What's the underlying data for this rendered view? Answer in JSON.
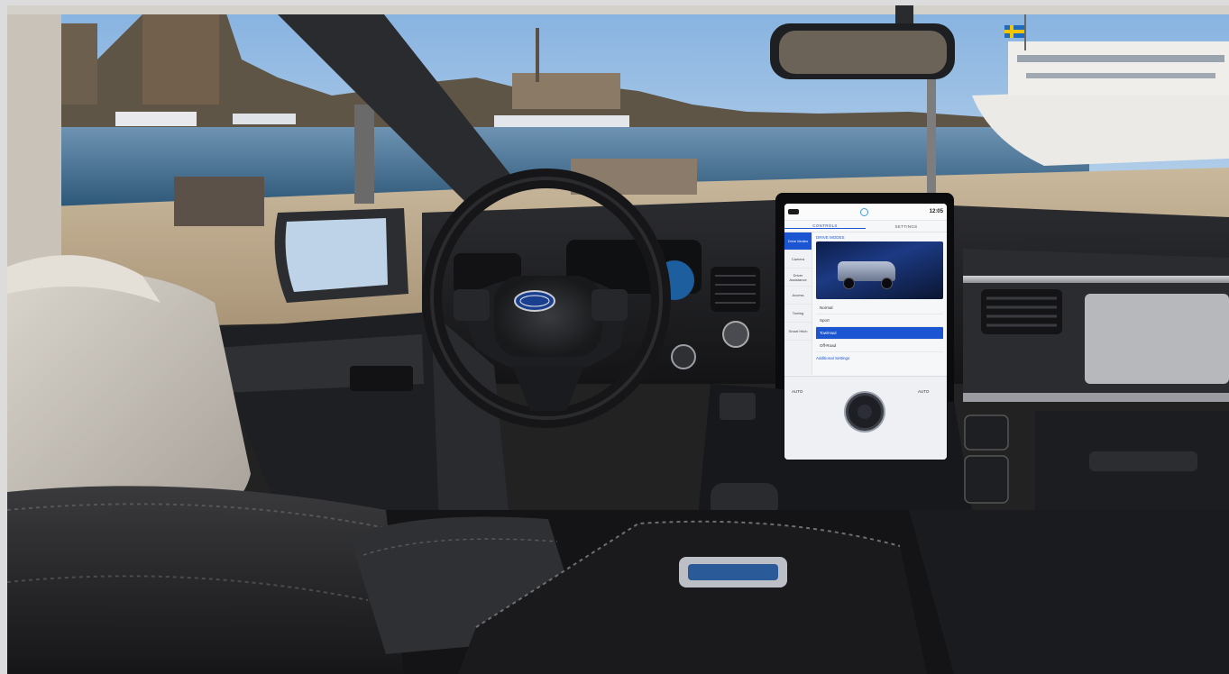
{
  "scene": {
    "subject": "pickup-truck-interior",
    "accent_colors": {
      "sky": "#9dc4ea",
      "water": "#2f5d7e",
      "leather": "#2a2a2c",
      "screen_blue": "#1b55d1"
    }
  },
  "infotainment": {
    "time": "12:05",
    "tabs": [
      "CONTROLS",
      "SETTINGS"
    ],
    "active_tab": "CONTROLS",
    "section_title": "DRIVE MODES",
    "sidebar": [
      {
        "label": "Drive Modes",
        "active": true
      },
      {
        "label": "Camera",
        "active": false
      },
      {
        "label": "Driver Assistance",
        "active": false
      },
      {
        "label": "Access",
        "active": false
      },
      {
        "label": "Towing",
        "active": false
      },
      {
        "label": "Smart Hitch",
        "active": false
      }
    ],
    "modes": [
      {
        "label": "Normal",
        "active": false
      },
      {
        "label": "Sport",
        "active": false
      },
      {
        "label": "Tow/Haul",
        "active": true
      },
      {
        "label": "Off-Road",
        "active": false
      }
    ],
    "link": "Additional Settings",
    "climate": {
      "left": "AUTO",
      "right": "AUTO"
    }
  },
  "steering_wheel": {
    "logo": "Ford",
    "icon": "ford-oval-icon"
  }
}
